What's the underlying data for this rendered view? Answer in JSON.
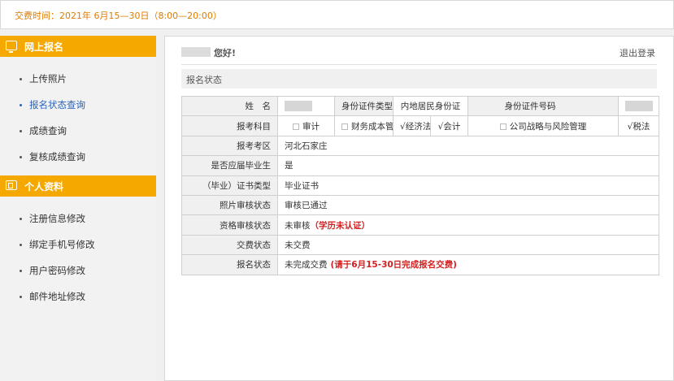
{
  "notice": {
    "text": "交费时间：2021年 6月15—30日（8:00—20:00）"
  },
  "sidebar": {
    "sections": [
      {
        "title": "网上报名",
        "icon": "monitor-icon",
        "items": [
          {
            "label": "上传照片",
            "active": false
          },
          {
            "label": "报名状态查询",
            "active": true
          },
          {
            "label": "成绩查询",
            "active": false
          },
          {
            "label": "复核成绩查询",
            "active": false
          }
        ]
      },
      {
        "title": "个人资料",
        "icon": "id-card-icon",
        "items": [
          {
            "label": "注册信息修改",
            "active": false
          },
          {
            "label": "绑定手机号修改",
            "active": false
          },
          {
            "label": "用户密码修改",
            "active": false
          },
          {
            "label": "邮件地址修改",
            "active": false
          }
        ]
      }
    ]
  },
  "header": {
    "greeting": "您好!",
    "logout": "退出登录"
  },
  "status_section": {
    "title": "报名状态"
  },
  "table": {
    "name_label": "姓　名",
    "id_type_label": "身份证件类型",
    "id_type_value": "内地居民身份证",
    "id_number_label": "身份证件号码",
    "subjects_label": "报考科目",
    "subjects": [
      {
        "name": "审计",
        "mark": "checkbox"
      },
      {
        "name": "财务成本管理",
        "mark": "checkbox"
      },
      {
        "name": "经济法",
        "mark": "√"
      },
      {
        "name": "会计",
        "mark": "√"
      },
      {
        "name": "公司战略与风险管理",
        "mark": "checkbox"
      },
      {
        "name": "税法",
        "mark": "√"
      }
    ],
    "rows": [
      {
        "label": "报考考区",
        "value": "河北石家庄",
        "note": ""
      },
      {
        "label": "是否应届毕业生",
        "value": "是",
        "note": ""
      },
      {
        "label": "（毕业）证书类型",
        "value": "毕业证书",
        "note": ""
      },
      {
        "label": "照片审核状态",
        "value": "审核已通过",
        "note": ""
      },
      {
        "label": "资格审核状态",
        "value": "未审核",
        "note": "（学历未认证）"
      },
      {
        "label": "交费状态",
        "value": "未交费",
        "note": ""
      },
      {
        "label": "报名状态",
        "value": "未完成交费",
        "note": "(请于6月15-30日完成报名交费)"
      }
    ]
  },
  "colors": {
    "accent": "#f5a800",
    "notice": "#e07b00",
    "alert": "#d42020",
    "link_active": "#2a63b8"
  }
}
